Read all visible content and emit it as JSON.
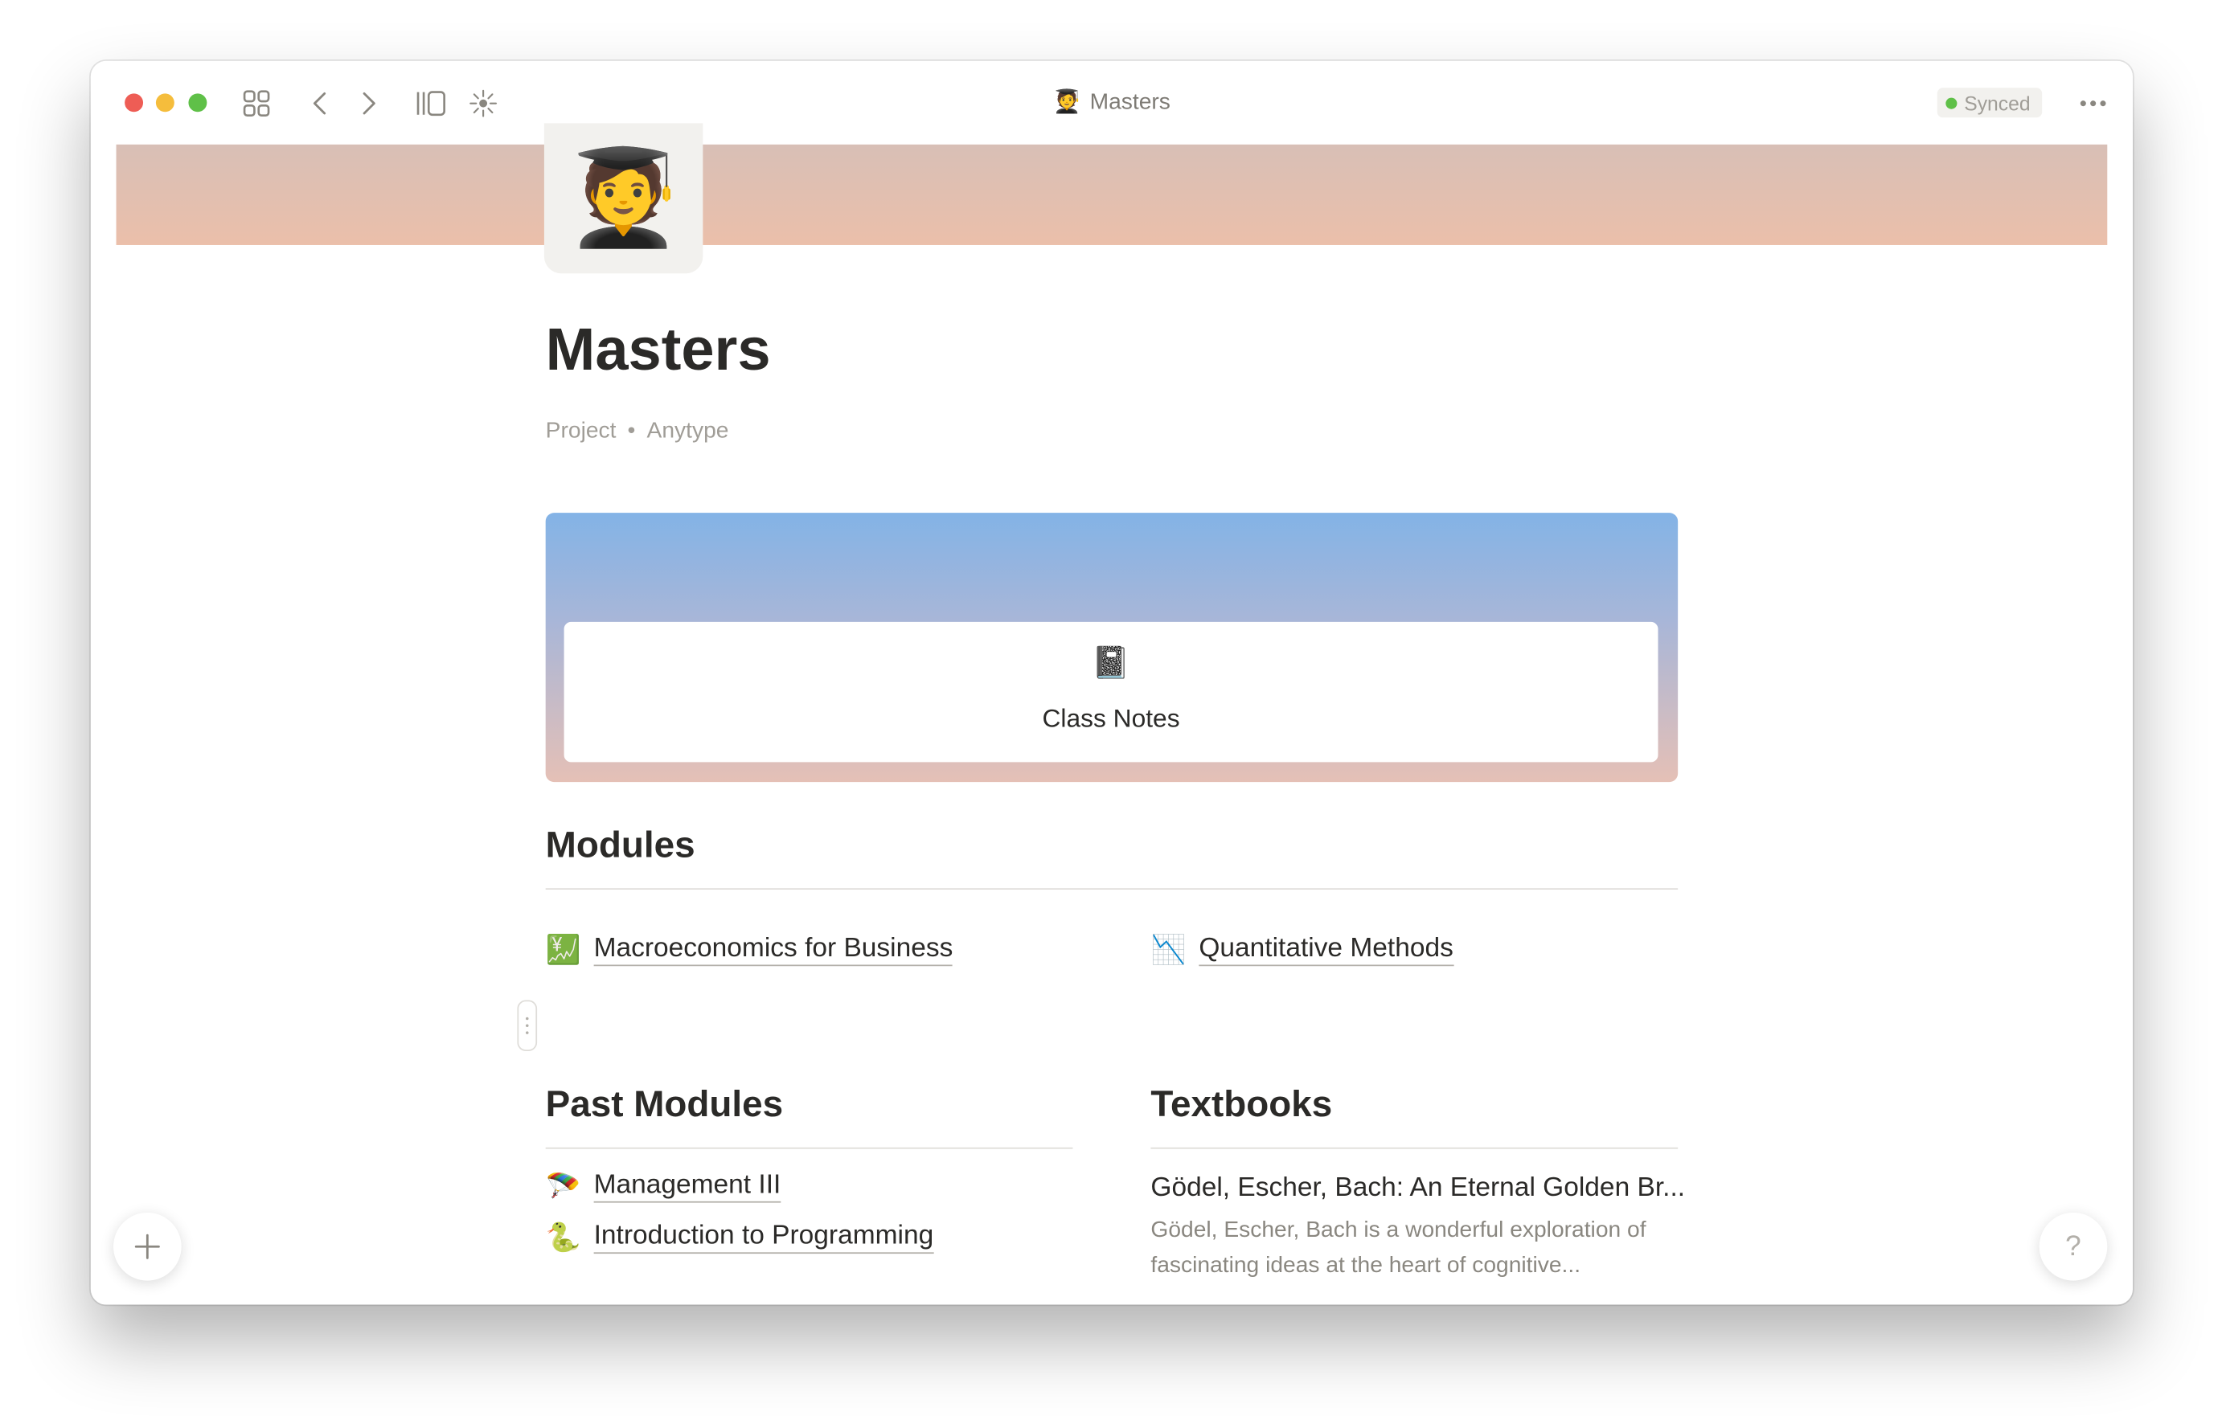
{
  "window": {
    "title": "Masters",
    "title_emoji": "🧑‍🎓",
    "sync_status": "Synced",
    "sync_color": "#5fc048"
  },
  "toolbar": {
    "icons": [
      "dashboard-grid-icon",
      "back-arrow-icon",
      "forward-arrow-icon",
      "sidebar-toggle-icon",
      "graph-icon",
      "more-icon"
    ]
  },
  "page": {
    "icon": "🧑‍🎓",
    "title": "Masters",
    "type": "Project",
    "separator": "•",
    "space": "Anytype"
  },
  "featured": {
    "icon": "📓",
    "label": "Class Notes"
  },
  "modules": {
    "heading": "Modules",
    "items": [
      {
        "icon": "💹",
        "label": "Macroeconomics for Business"
      },
      {
        "icon": "📉",
        "label": "Quantitative Methods"
      }
    ]
  },
  "past_modules": {
    "heading": "Past Modules",
    "items": [
      {
        "icon": "🪂",
        "label": "Management III"
      },
      {
        "icon": "🐍",
        "label": "Introduction to Programming"
      }
    ]
  },
  "textbooks": {
    "heading": "Textbooks",
    "items": [
      {
        "title": "Gödel, Escher, Bach: An Eternal Golden Br...",
        "description": "Gödel, Escher, Bach is a wonderful exploration of fascinating ideas at the heart of cognitive..."
      }
    ]
  },
  "fabs": {
    "help_label": "?"
  }
}
